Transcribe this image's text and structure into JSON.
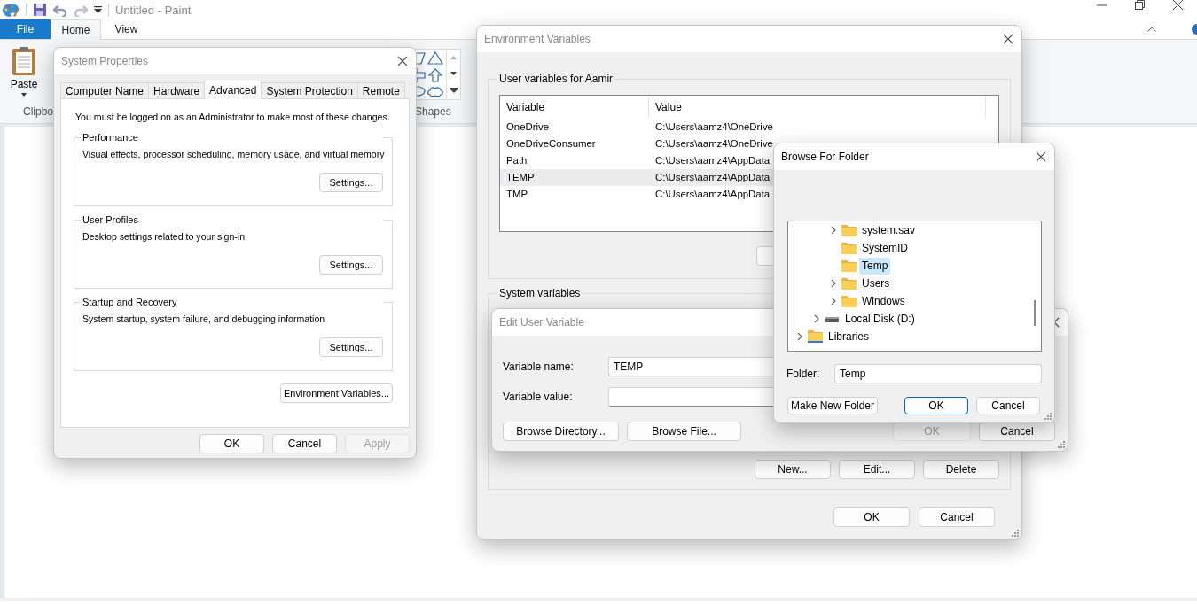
{
  "paint": {
    "title": "Untitled - Paint",
    "tabs": [
      {
        "label": "File",
        "kind": "menu",
        "selected": false
      },
      {
        "label": "Home",
        "kind": "tab",
        "selected": true
      },
      {
        "label": "View",
        "kind": "tab",
        "selected": false
      }
    ],
    "paste_label": "Paste",
    "group_labels": [
      "Clipbo",
      "Shapes"
    ]
  },
  "system_properties": {
    "title": "System Properties",
    "tabs": [
      {
        "label": "Computer Name",
        "selected": false
      },
      {
        "label": "Hardware",
        "selected": false
      },
      {
        "label": "Advanced",
        "selected": true
      },
      {
        "label": "System Protection",
        "selected": false
      },
      {
        "label": "Remote",
        "selected": false
      }
    ],
    "note": "You must be logged on as an Administrator to make most of these changes.",
    "groups": [
      {
        "title": "Performance",
        "description": "Visual effects, processor scheduling, memory usage, and virtual memory",
        "button": "Settings..."
      },
      {
        "title": "User Profiles",
        "description": "Desktop settings related to your sign-in",
        "button": "Settings..."
      },
      {
        "title": "Startup and Recovery",
        "description": "System startup, system failure, and debugging information",
        "button": "Settings..."
      }
    ],
    "env_button": "Environment Variables...",
    "buttons": [
      {
        "label": "OK",
        "disabled": false
      },
      {
        "label": "Cancel",
        "disabled": false
      },
      {
        "label": "Apply",
        "disabled": true
      }
    ]
  },
  "environment_variables": {
    "title": "Environment Variables",
    "user_group": "User variables for Aamir",
    "columns": [
      "Variable",
      "Value"
    ],
    "rows": [
      {
        "variable": "OneDrive",
        "value": "C:\\Users\\aamz4\\OneDrive",
        "selected": false
      },
      {
        "variable": "OneDriveConsumer",
        "value": "C:\\Users\\aamz4\\OneDrive",
        "selected": false
      },
      {
        "variable": "Path",
        "value": "C:\\Users\\aamz4\\AppData",
        "selected": false
      },
      {
        "variable": "TEMP",
        "value": "C:\\Users\\aamz4\\AppData",
        "selected": true
      },
      {
        "variable": "TMP",
        "value": "C:\\Users\\aamz4\\AppData",
        "selected": false
      }
    ],
    "system_group": "System variables",
    "system_buttons": [
      "New...",
      "Edit...",
      "Delete"
    ],
    "buttons": [
      "OK",
      "Cancel"
    ]
  },
  "edit_user_variable": {
    "title": "Edit User Variable",
    "fields": [
      {
        "label": "Variable name:",
        "value": "TEMP"
      },
      {
        "label": "Variable value:"
      }
    ],
    "browse_buttons": [
      "Browse Directory...",
      "Browse File..."
    ],
    "buttons": [
      {
        "label": "OK",
        "disabled": true
      },
      {
        "label": "Cancel",
        "disabled": false
      }
    ]
  },
  "browse_for_folder": {
    "title": "Browse For Folder",
    "tree": [
      {
        "children": [
          {
            "children": [
              {
                "label": "system.sav",
                "kind": "folder",
                "expandable": true,
                "selected": false
              },
              {
                "label": "SystemID",
                "kind": "folder",
                "expandable": false,
                "selected": false
              },
              {
                "label": "Temp",
                "kind": "folder",
                "expandable": false,
                "selected": true
              },
              {
                "label": "Users",
                "kind": "folder",
                "expandable": true,
                "selected": false
              },
              {
                "label": "Windows",
                "kind": "folder",
                "expandable": true,
                "selected": false
              }
            ]
          },
          {
            "label": "Local Disk (D:)",
            "kind": "drive",
            "expandable": true,
            "selected": false
          }
        ]
      },
      {
        "label": "Libraries",
        "kind": "library",
        "expandable": true,
        "selected": false
      }
    ],
    "folder_label": "Folder:",
    "folder_value": "Temp",
    "buttons": [
      {
        "label": "Make New Folder",
        "default": false
      },
      {
        "label": "OK",
        "default": true
      },
      {
        "label": "Cancel",
        "default": false
      }
    ]
  }
}
